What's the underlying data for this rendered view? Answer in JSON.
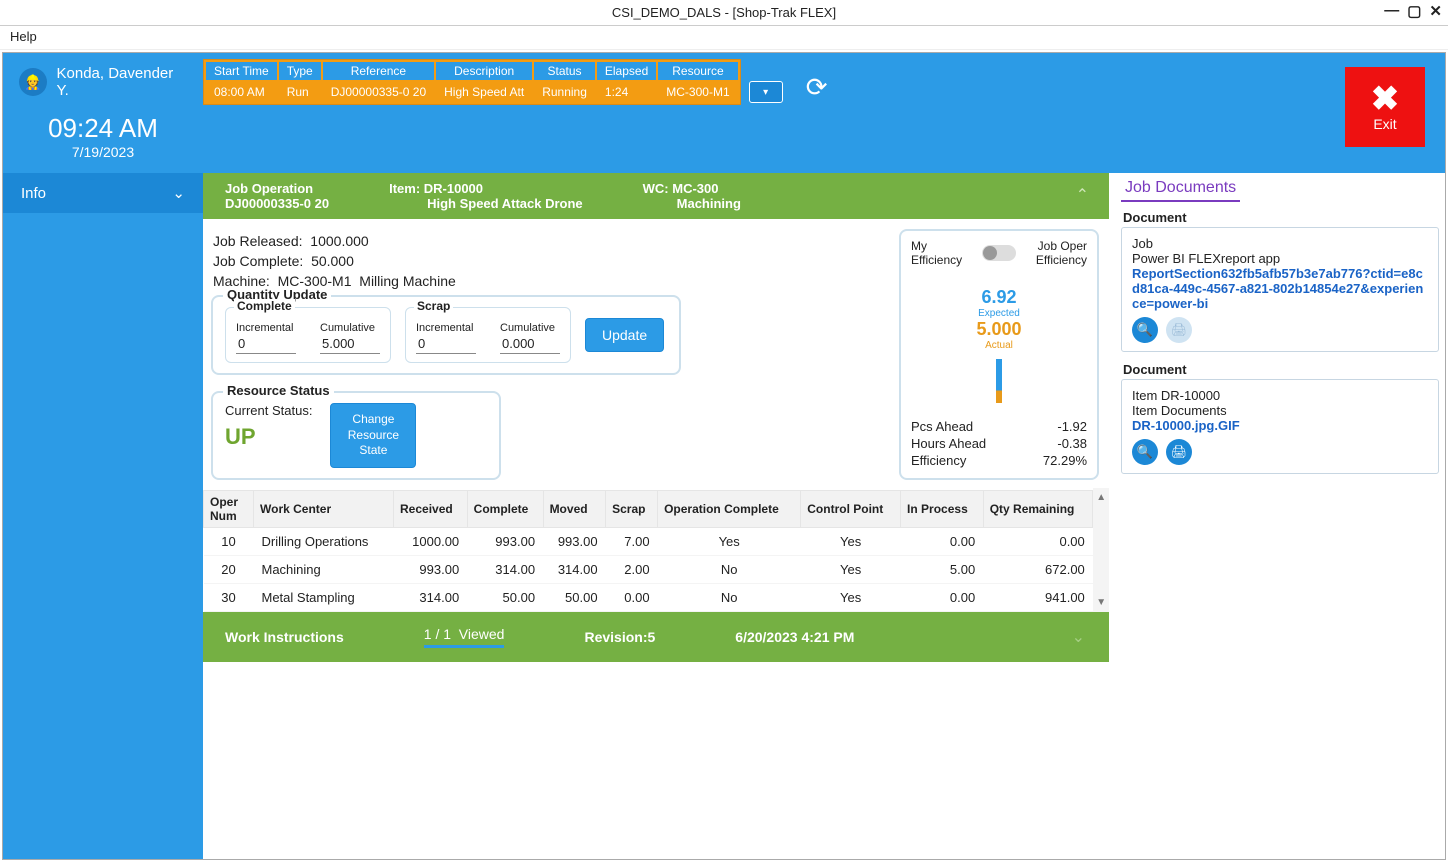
{
  "window": {
    "title": "CSI_DEMO_DALS - [Shop-Trak FLEX]",
    "menu_help": "Help",
    "min": "—",
    "max": "▢",
    "close": "✕"
  },
  "header": {
    "user": "Konda, Davender Y.",
    "time": "09:24 AM",
    "date": "7/19/2023",
    "job_cols": {
      "start": "Start Time",
      "type": "Type",
      "ref": "Reference",
      "desc": "Description",
      "status": "Status",
      "elapsed": "Elapsed",
      "resource": "Resource"
    },
    "job_row": {
      "start": "08:00 AM",
      "type": "Run",
      "ref": "DJ00000335-0 20",
      "desc": "High Speed Att",
      "status": "Running",
      "elapsed": "1:24",
      "resource": "MC-300-M1"
    },
    "exit": "Exit"
  },
  "sidebar": {
    "info": "Info"
  },
  "greenbar": {
    "jobop_label": "Job Operation",
    "jobop_val": "DJ00000335-0   20",
    "item_label": "Item:  DR-10000",
    "item_desc": "High Speed Attack Drone",
    "wc_label": "WC:  MC-300",
    "wc_desc": "Machining"
  },
  "info": {
    "released_label": "Job Released:",
    "released": "1000.000",
    "complete_label": "Job Complete:",
    "complete": "50.000",
    "machine_label": "Machine:",
    "machine_id": "MC-300-M1",
    "machine_name": "Milling Machine"
  },
  "qty": {
    "panel": "Quantity Update",
    "complete": "Complete",
    "scrap": "Scrap",
    "inc": "Incremental",
    "cum": "Cumulative",
    "c_inc": "0",
    "c_cum": "5.000",
    "s_inc": "0",
    "s_cum": "0.000",
    "update": "Update"
  },
  "rstat": {
    "panel": "Resource Status",
    "label": "Current Status:",
    "value": "UP",
    "btn": "Change Resource State"
  },
  "eff": {
    "my": "My Efficiency",
    "oper": "Job Oper Efficiency",
    "expected": "6.92",
    "expected_lbl": "Expected",
    "actual": "5.000",
    "actual_lbl": "Actual",
    "pcs_lbl": "Pcs Ahead",
    "pcs": "-1.92",
    "hrs_lbl": "Hours Ahead",
    "hrs": "-0.38",
    "eff_lbl": "Efficiency",
    "eff": "72.29%"
  },
  "ops": {
    "cols": {
      "num": "Oper Num",
      "wc": "Work Center",
      "recv": "Received",
      "comp": "Complete",
      "moved": "Moved",
      "scrap": "Scrap",
      "opc": "Operation Complete",
      "cp": "Control Point",
      "ip": "In Process",
      "qr": "Qty Remaining"
    },
    "rows": [
      {
        "num": "10",
        "wc": "Drilling Operations",
        "recv": "1000.00",
        "comp": "993.00",
        "moved": "993.00",
        "scrap": "7.00",
        "opc": "Yes",
        "cp": "Yes",
        "ip": "0.00",
        "qr": "0.00"
      },
      {
        "num": "20",
        "wc": "Machining",
        "recv": "993.00",
        "comp": "314.00",
        "moved": "314.00",
        "scrap": "2.00",
        "opc": "No",
        "cp": "Yes",
        "ip": "5.00",
        "qr": "672.00"
      },
      {
        "num": "30",
        "wc": "Metal Stampling",
        "recv": "314.00",
        "comp": "50.00",
        "moved": "50.00",
        "scrap": "0.00",
        "opc": "No",
        "cp": "Yes",
        "ip": "0.00",
        "qr": "941.00"
      }
    ]
  },
  "wi": {
    "label": "Work Instructions",
    "count": "1 / 1",
    "viewed": "Viewed",
    "rev": "Revision:5",
    "date": "6/20/2023 4:21 PM"
  },
  "docs": {
    "title": "Job Documents",
    "d1_head": "Document",
    "d1_l1": "Job",
    "d1_l2": "Power BI FLEXreport app",
    "d1_link": "ReportSection632fb5afb57b3e7ab776?ctid=e8cd81ca-449c-4567-a821-802b14854e27&experience=power-bi",
    "d2_head": "Document",
    "d2_l1": "Item DR-10000",
    "d2_l2": "Item Documents",
    "d2_link": "DR-10000.jpg.GIF"
  }
}
